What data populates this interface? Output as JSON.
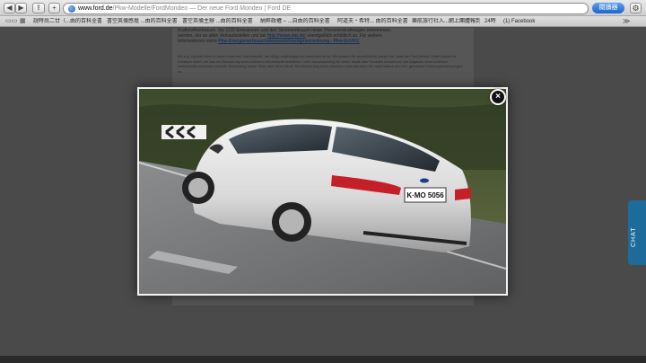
{
  "browser": {
    "nav": {
      "back": "◀",
      "forward": "▶",
      "share": "⇪",
      "new_tab": "+"
    },
    "address": {
      "domain": "www.ford.de",
      "path": "/Pkw-Modelle/FordMondeo",
      "separator": " — ",
      "page_title": "Der neue Ford Mondeo | Ford DE"
    },
    "search_button": "閱讀器",
    "settings_icon": "⚙",
    "bookmarks_overflow": "≫",
    "bookmarks": [
      "說時尚二廿（...由的百科全書",
      "書空英倫感覺 ...由的百科全書",
      "書空英倫主辦 ...由的百科全書",
      "納粹政權 – ...自由的百科全書",
      "阿道夫・希特... 由的百科全書",
      "樂航旅行社入...網上團體報到",
      "24時",
      "(1) Facebook"
    ]
  },
  "content": {
    "line1": "Kraftstoffverbrauch. Sie CO2-Emissionen und den Stromverbrauch neuer Personenkraftwagen entnommen",
    "line2a": "werden, der an allen Verkaufsstellen und bei ",
    "link1": "http://www.dat.de/",
    "line2b": " unentgeltlich erhältlich ist. Für weitere",
    "line3a": "Informationen siehe ",
    "link2": "Pkw-Energieverbrauchskennzeichnungsverordnung - Pkw-EnVKV.",
    "small": "Bei e.g. Hybrids führt zu einem externen Internetseite, die völlig unabhängig von www.ford.de ist. Wir weisen Sie ausdrücklich darauf hin, dass die Ford-Werke GmbH weder für Schäden haftet, die aus der Benutzung einer externen Internetseite entstehen, noch Verantwortung für deren Inhalt oder Funktion übernimmt. Die Angaben einer externen Internetseite bestimmt nicht die Einrichtung dieser Seite oder ihren Inhalt. Bei Aktivierung eines externen Links stimmen Sie automatisch den hier genannten Nutzungsbedingungen zu."
  },
  "lightbox": {
    "license_plate": "K·MO 5056",
    "close_icon": "×"
  },
  "chat_tab": "CHAT"
}
